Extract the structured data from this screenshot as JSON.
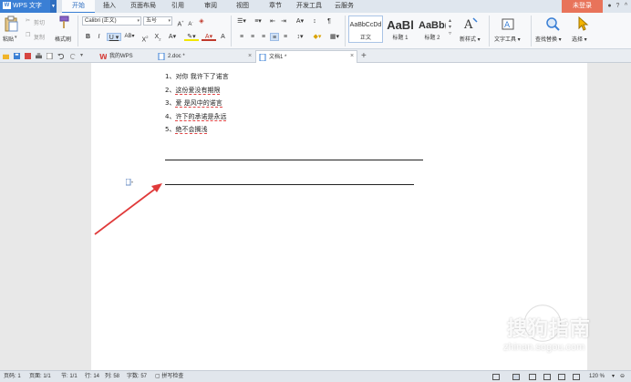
{
  "app": {
    "name": "WPS 文字",
    "logo_letter": "W",
    "accent_color": "#3a7fd5",
    "login_label": "未登录"
  },
  "menu": {
    "items": [
      "开始",
      "插入",
      "页面布局",
      "引用",
      "审阅",
      "视图",
      "章节",
      "开发工具",
      "云服务"
    ],
    "active": "开始"
  },
  "ribbon": {
    "paste": "粘贴",
    "cut": "剪切",
    "copy": "复制",
    "format_painter": "格式刷",
    "font_name": "Calibri (正文)",
    "font_size": "五号",
    "styles": [
      {
        "sample": "AaBbCcDd",
        "name": "正文"
      },
      {
        "sample": "AaBl",
        "name": "标题 1"
      },
      {
        "sample": "AaBb(",
        "name": "标题 2"
      }
    ],
    "new_style": "新样式",
    "text_tool": "文字工具",
    "find_replace": "查找替换",
    "select": "选择"
  },
  "tabs": [
    {
      "label": "我的WPS",
      "icon": "wps-logo-icon"
    },
    {
      "label": "2.doc *",
      "icon": "doc-icon"
    },
    {
      "label": "文档1 *",
      "icon": "doc-icon",
      "active": true
    }
  ],
  "document": {
    "lines": [
      {
        "num": "1、",
        "text": "对你  我许下了诺言",
        "squiggle": false
      },
      {
        "num": "2、",
        "text": "这份爱没有期限",
        "squiggle": true
      },
      {
        "num": "3、",
        "text": "爱  是风中的诺言",
        "squiggle": true
      },
      {
        "num": "4、",
        "text": "许下的承诺是永远",
        "squiggle": true
      },
      {
        "num": "5、",
        "text": "绝不会搁浅",
        "squiggle": true
      }
    ]
  },
  "watermark": {
    "title": "搜狗指南",
    "url": "zhinan.sogou.com"
  },
  "status": {
    "page_num": "页码: 1",
    "pages": "页面: 1/1",
    "section": "节: 1/1",
    "row": "行: 14",
    "col": "列: 58",
    "words": "字数: 57",
    "spell": "拼写检查",
    "zoom": "120 %"
  }
}
